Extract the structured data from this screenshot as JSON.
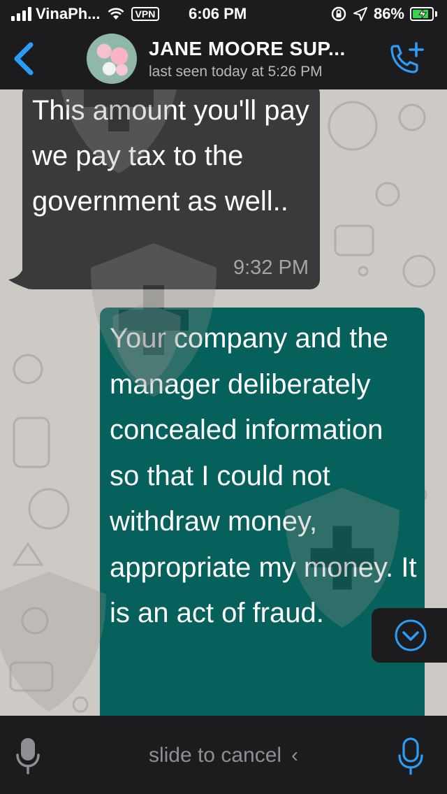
{
  "status_bar": {
    "carrier": "VinaPh...",
    "vpn_label": "VPN",
    "time": "6:06 PM",
    "battery": "86%",
    "battery_level": 0.86,
    "icons": [
      "signal-bars-icon",
      "wifi-icon",
      "screen-lock-rotation-icon",
      "location-arrow-icon",
      "battery-charging-icon"
    ]
  },
  "header": {
    "contact_name": "JANE MOORE SUP...",
    "last_seen": "last seen today at 5:26 PM",
    "icons": [
      "back-chevron-icon",
      "add-call-icon"
    ]
  },
  "messages": [
    {
      "direction": "incoming",
      "text": "This amount you'll pay we pay tax to the government as well..",
      "time": "9:32 PM"
    },
    {
      "direction": "outgoing",
      "text": "Your company and the manager deliberately concealed information so that I could not withdraw money, appropriate my money. It is an act of fraud."
    }
  ],
  "recording_bar": {
    "slide_label": "slide to cancel",
    "chevron": "‹",
    "icons": [
      "microphone-icon",
      "microphone-active-icon"
    ]
  },
  "colors": {
    "bar_background": "#1c1c1e",
    "accent_blue": "#2c9df7",
    "incoming_bubble": "#3a3a3c",
    "outgoing_bubble": "#06605b",
    "chat_background": "#cdcac5",
    "battery_green": "#32d74b"
  }
}
